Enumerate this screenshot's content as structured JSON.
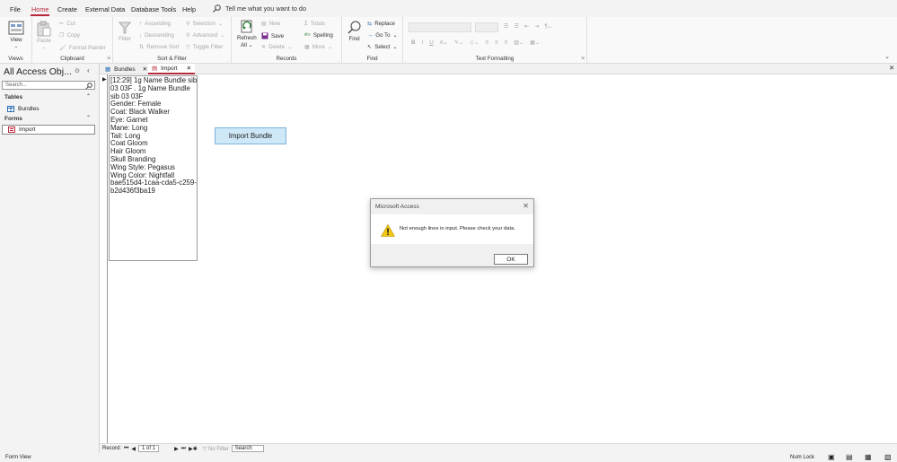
{
  "menu": {
    "tabs": [
      "File",
      "Home",
      "Create",
      "External Data",
      "Database Tools",
      "Help"
    ],
    "tell_me": "Tell me what you want to do"
  },
  "ribbon": {
    "views": {
      "label": "Views",
      "view": "View"
    },
    "clipboard": {
      "label": "Clipboard",
      "paste": "Paste",
      "cut": "Cut",
      "copy": "Copy",
      "format_painter": "Format Painter"
    },
    "sort_filter": {
      "label": "Sort & Filter",
      "filter": "Filter",
      "ascending": "Ascending",
      "descending": "Descending",
      "remove_sort": "Remove Sort",
      "selection": "Selection",
      "advanced": "Advanced",
      "toggle_filter": "Toggle Filter"
    },
    "records": {
      "label": "Records",
      "refresh": "Refresh",
      "refresh_all": "All",
      "new": "New",
      "save": "Save",
      "delete": "Delete",
      "totals": "Totals",
      "spelling": "Spelling",
      "more": "More"
    },
    "find": {
      "label": "Find",
      "find": "Find",
      "replace": "Replace",
      "goto": "Go To",
      "select": "Select"
    },
    "text_formatting": {
      "label": "Text Formatting"
    }
  },
  "nav": {
    "title": "All Access Obj...",
    "search_placeholder": "Search...",
    "sections": [
      {
        "header": "Tables",
        "items": [
          "Bundles"
        ]
      },
      {
        "header": "Forms",
        "items": [
          "Import"
        ]
      }
    ]
  },
  "doc_tabs": [
    {
      "label": "Bundles",
      "active": false
    },
    {
      "label": "Import",
      "active": true
    }
  ],
  "form": {
    "input_lines": [
      "[12:29] 1g Name Bundle sib",
      "03 03F . 1g Name Bundle",
      "sib 03 03F",
      "Gender: Female",
      "Coat: Black Walker",
      "Eye: Garnet",
      "Mane: Long",
      "Tail: Long",
      "Coat Gloom",
      "Hair Gloom",
      "Skull Branding",
      "Wing Style: Pegasus",
      "Wing Color: Nightfall",
      "bae515d4-1caa-cda5-c259-",
      "b2d436f3ba19"
    ],
    "import_button": "Import Bundle"
  },
  "record_nav": {
    "label": "Record:",
    "position": "1 of 1",
    "filter": "No Filter",
    "search": "Search"
  },
  "status": {
    "left": "Form View",
    "num_lock": "Num Lock"
  },
  "dialog": {
    "title": "Microsoft Access",
    "message": "Not enough lines in input. Please check your data.",
    "ok": "OK"
  },
  "colors": {
    "accent": "#b7283a",
    "button_fill": "#cfe8f8",
    "warning": "#f2c811"
  }
}
